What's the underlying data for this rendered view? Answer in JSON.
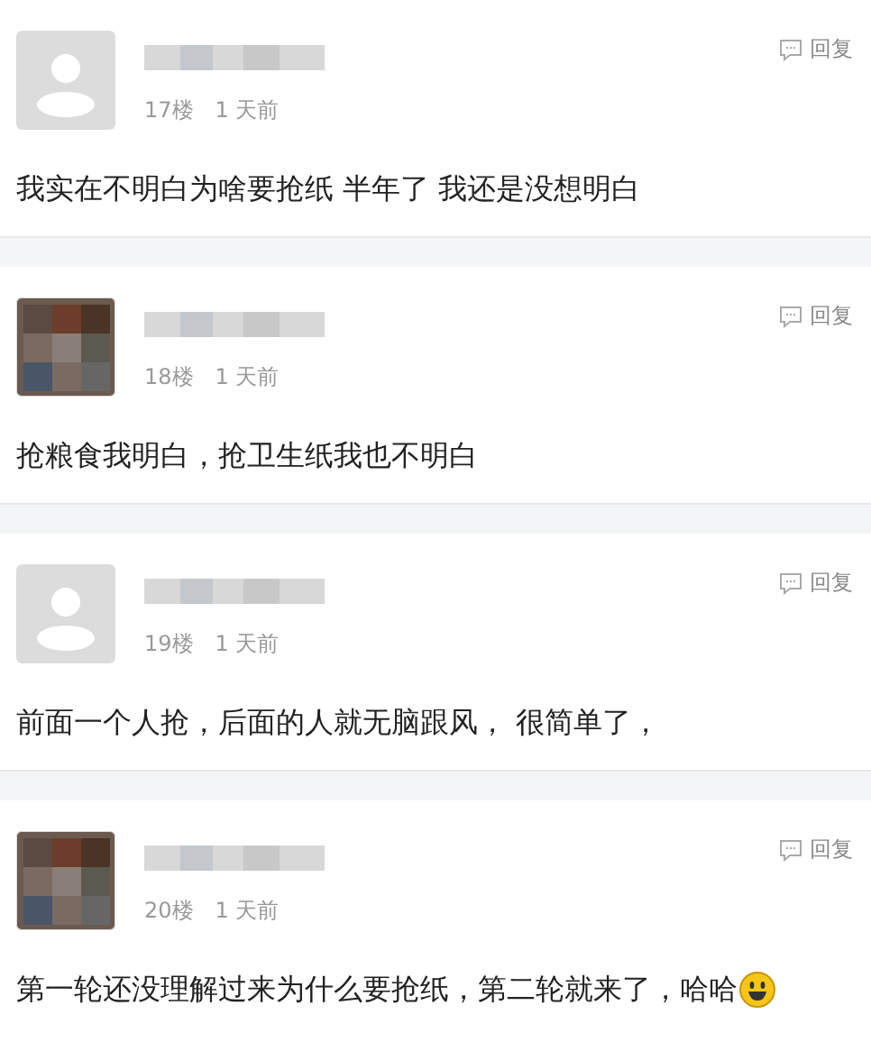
{
  "comments": [
    {
      "avatar": {
        "kind": "default"
      },
      "floor": "17楼",
      "time": "1 天前",
      "reply": "回复",
      "text": "我实在不明白为啥要抢纸 半年了 我还是没想明白",
      "emoji": false
    },
    {
      "floor": "18楼",
      "time": "1 天前",
      "reply": "回复",
      "text": "抢粮食我明白，抢卫生纸我也不明白",
      "emoji": false
    },
    {
      "avatar": {
        "kind": "default"
      },
      "floor": "19楼",
      "time": "1 天前",
      "reply": "回复",
      "text": "前面一个人抢，后面的人就无脑跟风， 很简单了，",
      "emoji": false
    },
    {
      "floor": "20楼",
      "time": "1 天前",
      "reply": "回复",
      "text": "第一轮还没理解过来为什么要抢纸，第二轮就来了，哈哈",
      "emoji": true
    }
  ]
}
